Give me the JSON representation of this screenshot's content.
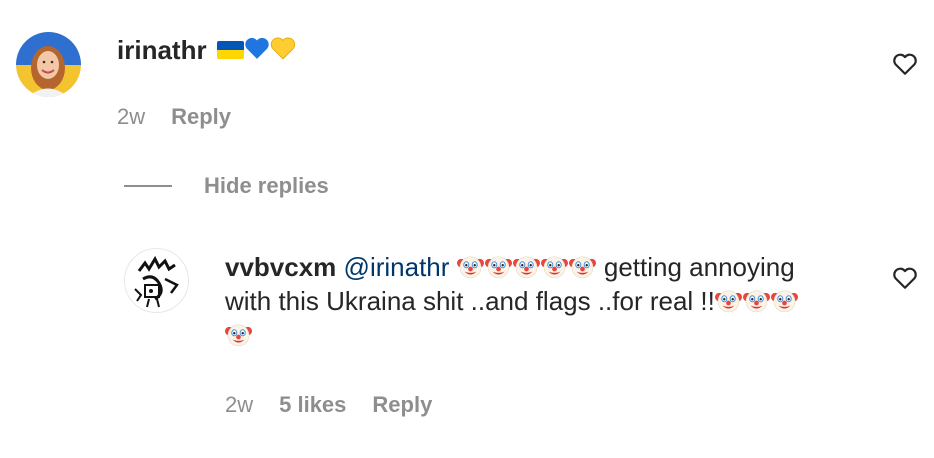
{
  "comment": {
    "username": "irinathr",
    "text_emoji": [
      "ukraine-flag",
      "blue-heart",
      "yellow-heart"
    ],
    "time": "2w",
    "reply_label": "Reply"
  },
  "replies_toggle": {
    "label": "Hide replies"
  },
  "reply": {
    "username": "vvbvcxm",
    "mention": "@irinathr",
    "text_part1": "getting annoying",
    "text_part2": "with this Ukraina shit ..and flags ..for real !!",
    "time": "2w",
    "likes": "5 likes",
    "reply_label": "Reply"
  },
  "colors": {
    "text": "#262626",
    "meta": "#8e8e8e",
    "mention": "#00376b",
    "divider": "#8e8e8e",
    "flag_blue": "#0057b7",
    "flag_yellow": "#ffd700"
  }
}
